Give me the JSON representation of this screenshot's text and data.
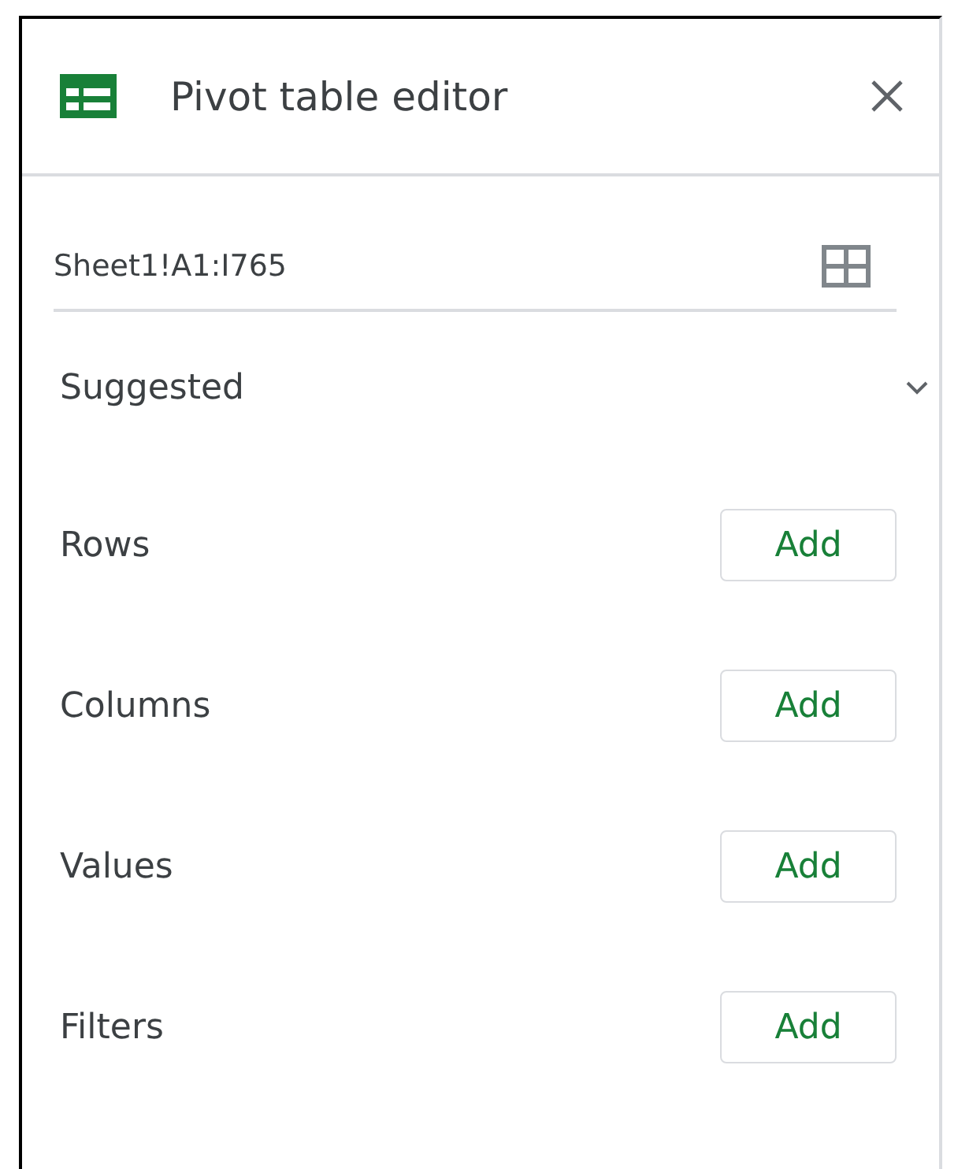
{
  "panel": {
    "title": "Pivot table editor"
  },
  "range": {
    "value": "Sheet1!A1:I765"
  },
  "suggested": {
    "label": "Suggested",
    "expanded": false
  },
  "sections": [
    {
      "label": "Rows",
      "button": "Add"
    },
    {
      "label": "Columns",
      "button": "Add"
    },
    {
      "label": "Values",
      "button": "Add"
    },
    {
      "label": "Filters",
      "button": "Add"
    }
  ]
}
